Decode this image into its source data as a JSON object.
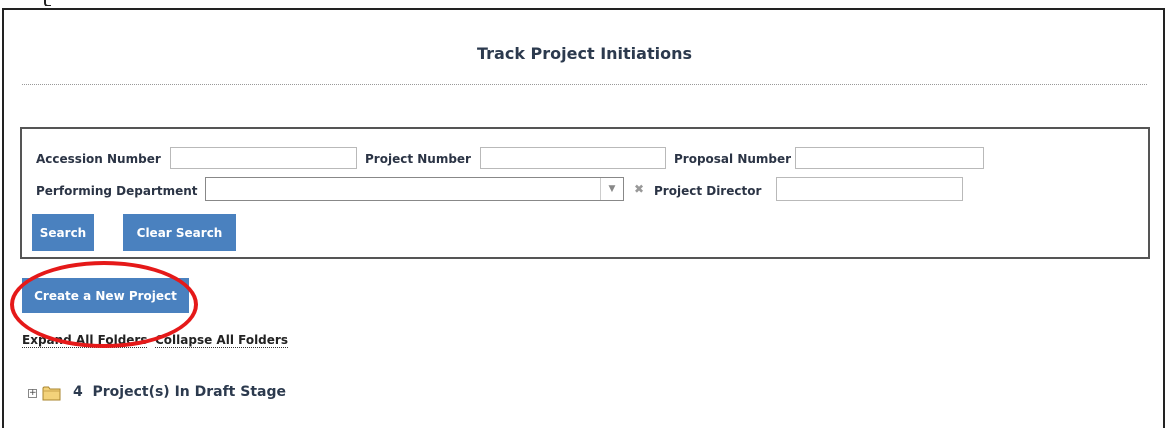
{
  "page": {
    "title": "Track Project Initiations"
  },
  "search": {
    "accession_label": "Accession Number",
    "accession_value": "",
    "project_number_label": "Project Number",
    "project_number_value": "",
    "proposal_label": "Proposal Number",
    "proposal_value": "",
    "department_label": "Performing Department",
    "department_value": "",
    "director_label": "Project Director",
    "director_value": "",
    "search_button": "Search",
    "clear_button": "Clear Search"
  },
  "actions": {
    "create_button": "Create a New Project",
    "expand_all": "Expand All Folders",
    "collapse_all": "Collapse All Folders"
  },
  "tree": {
    "items": [
      {
        "count": "4",
        "label": "Project(s) In Draft Stage",
        "icon": "folder-icon"
      }
    ]
  },
  "colors": {
    "button_bg": "#4a81bf",
    "highlight_ring": "#e51919",
    "title_color": "#2c3a4e"
  }
}
